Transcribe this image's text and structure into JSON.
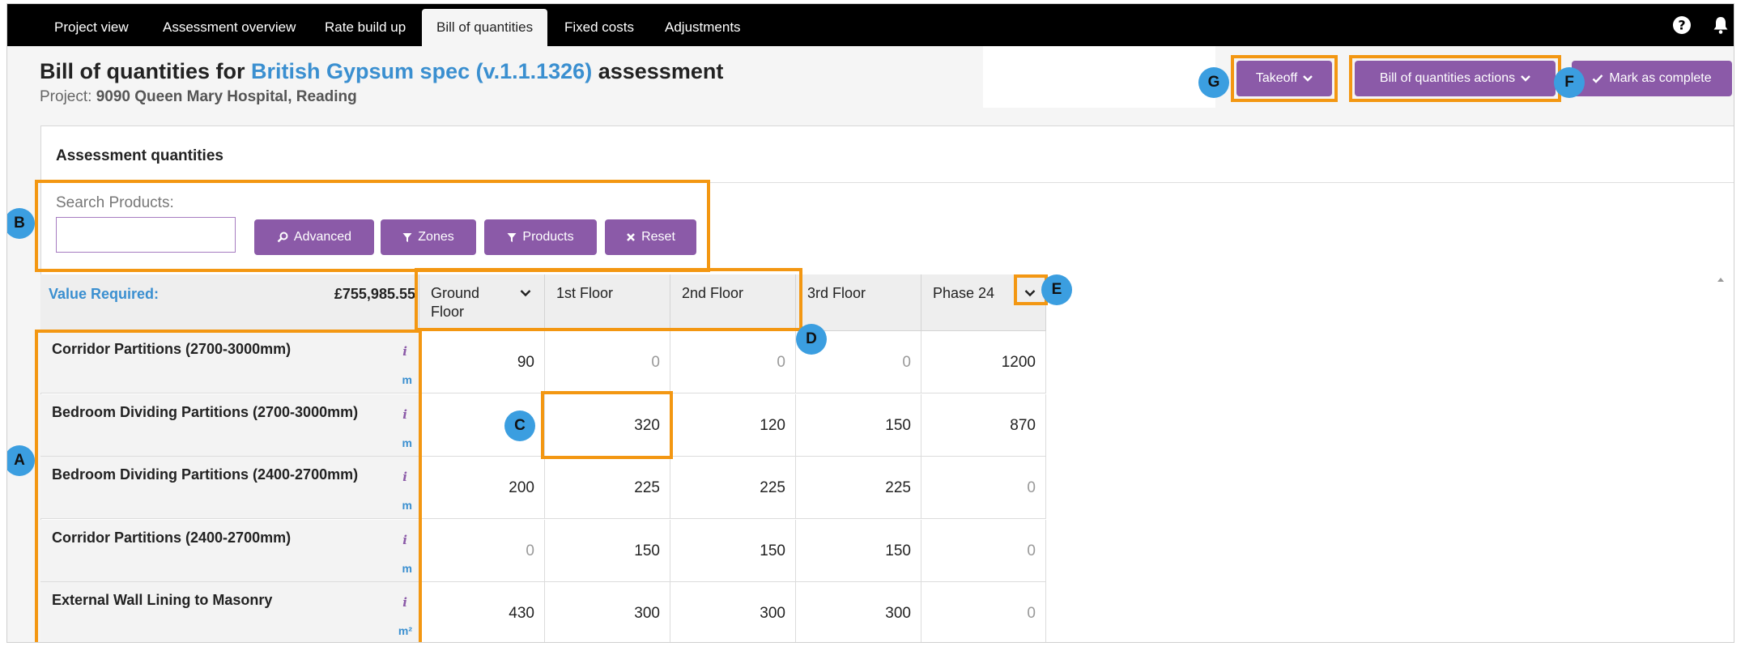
{
  "nav": {
    "tabs": [
      {
        "label": "Project view"
      },
      {
        "label": "Assessment overview"
      },
      {
        "label": "Rate build up"
      },
      {
        "label": "Bill of quantities"
      },
      {
        "label": "Fixed costs"
      },
      {
        "label": "Adjustments"
      }
    ],
    "active_tab": "Bill of quantities",
    "help_icon": "question-circle-icon",
    "bell_icon": "bell-icon"
  },
  "header": {
    "title_prefix": "Bill of quantities for",
    "title_link": "British Gypsum spec (v.1.1.1326)",
    "title_suffix": "assessment",
    "project_label": "Project:",
    "project_name": "9090 Queen Mary Hospital, Reading"
  },
  "actions": {
    "takeoff": "Takeoff",
    "boq_actions": "Bill of quantities actions",
    "mark_complete": "Mark as complete"
  },
  "panel": {
    "title": "Assessment quantities",
    "search_label": "Search Products:",
    "search_value": "",
    "buttons": {
      "advanced": "Advanced",
      "zones": "Zones",
      "products": "Products",
      "reset": "Reset"
    }
  },
  "table": {
    "value_required_label": "Value Required:",
    "value_required": "£755,985.55",
    "columns": [
      "Ground Floor",
      "1st Floor",
      "2nd Floor",
      "3rd Floor",
      "Phase 24"
    ],
    "rows": [
      {
        "name": "Corridor Partitions (2700-3000mm)",
        "unit": "m",
        "values": [
          "90",
          "0",
          "0",
          "0",
          "1200"
        ]
      },
      {
        "name": "Bedroom Dividing Partitions (2700-3000mm)",
        "unit": "m",
        "values": [
          "",
          "320",
          "120",
          "150",
          "870"
        ]
      },
      {
        "name": "Bedroom Dividing Partitions (2400-2700mm)",
        "unit": "m",
        "values": [
          "200",
          "225",
          "225",
          "225",
          "0"
        ]
      },
      {
        "name": "Corridor Partitions (2400-2700mm)",
        "unit": "m",
        "values": [
          "0",
          "150",
          "150",
          "150",
          "0"
        ]
      },
      {
        "name": "External Wall Lining to Masonry",
        "unit": "m²",
        "values": [
          "430",
          "300",
          "300",
          "300",
          "0"
        ]
      }
    ]
  },
  "callouts": {
    "a": "A",
    "b": "B",
    "c": "C",
    "d": "D",
    "e": "E",
    "f": "F",
    "g": "G"
  },
  "colors": {
    "nav_bg": "#000000",
    "accent_purple": "#8b5aa8",
    "link_blue": "#3a8fd0",
    "highlight_orange": "#f39712",
    "badge_blue": "#3b9ee0"
  }
}
